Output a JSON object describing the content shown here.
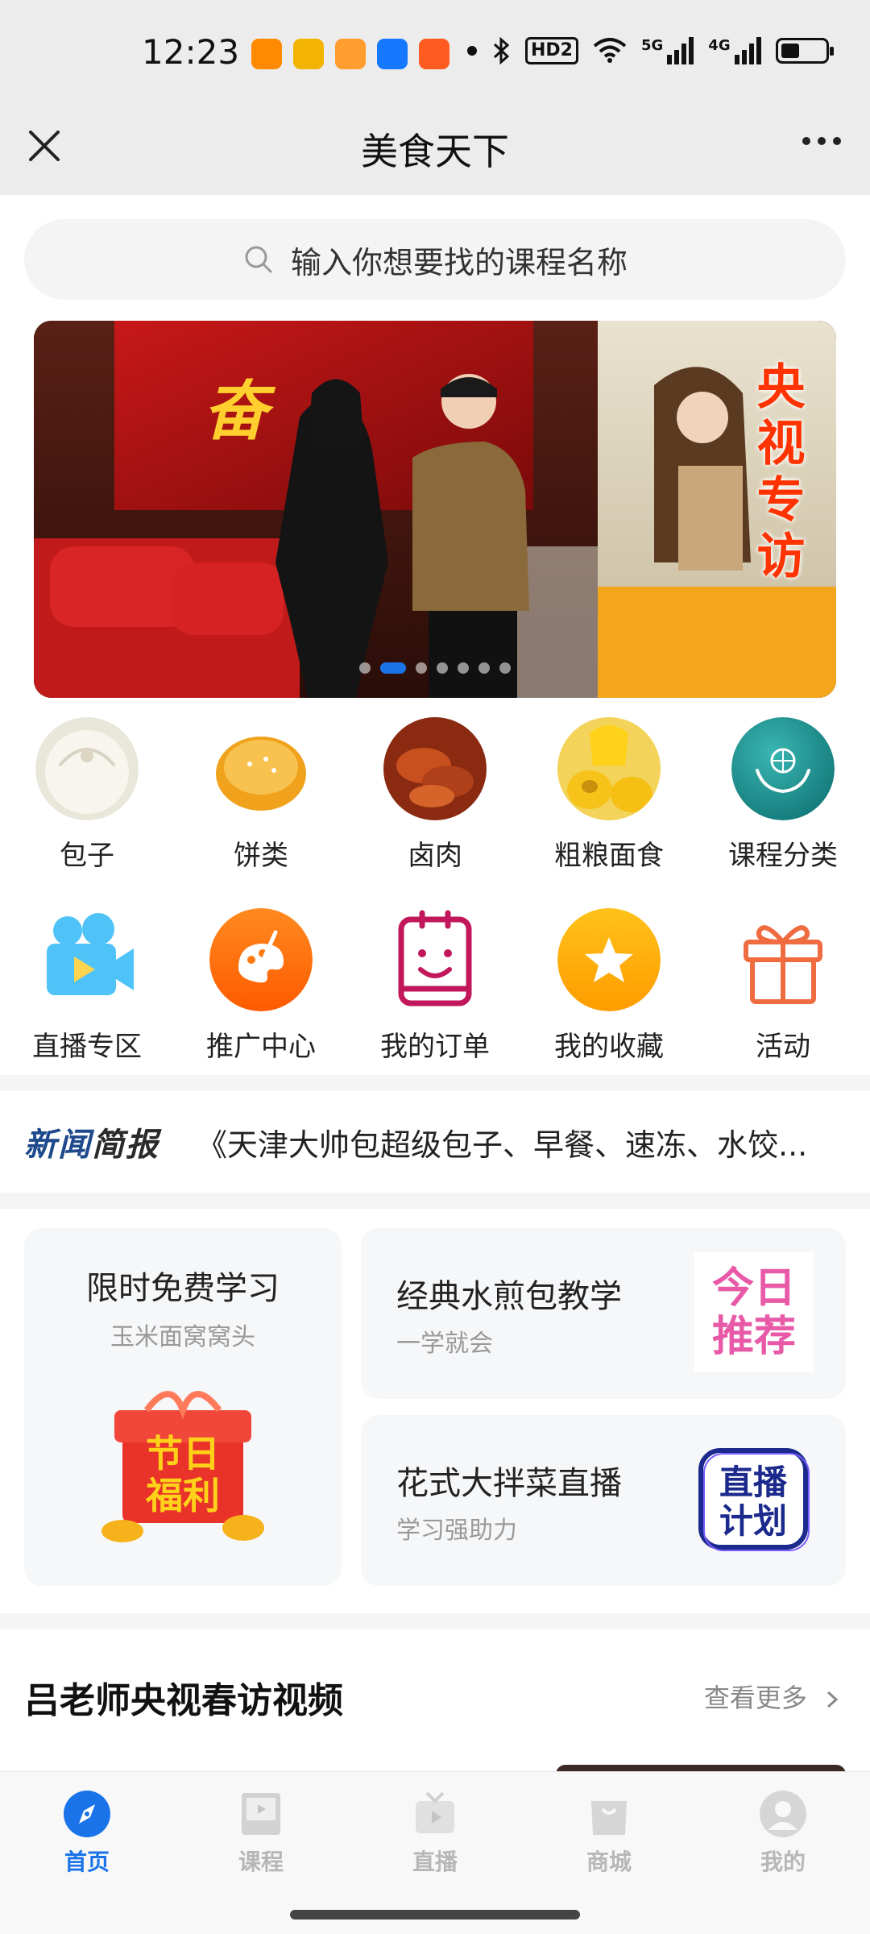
{
  "status_bar": {
    "time": "12:23",
    "hd_label": "HD2",
    "signal1_label": "5G",
    "signal2_label": "4G"
  },
  "title_bar": {
    "title": "美食天下"
  },
  "search": {
    "placeholder": "输入你想要找的课程名称"
  },
  "banner": {
    "tag_text": "央视专访",
    "slide_count": 7,
    "active_slide": 2
  },
  "categories": [
    {
      "label": "包子",
      "icon": "baozi-image"
    },
    {
      "label": "饼类",
      "icon": "pie-image"
    },
    {
      "label": "卤肉",
      "icon": "braised-meat-image"
    },
    {
      "label": "粗粮面食",
      "icon": "corn-wowotou-image"
    },
    {
      "label": "课程分类",
      "icon": "globe-hands-icon"
    }
  ],
  "quick_links": [
    {
      "label": "直播专区",
      "icon": "video-camera-icon"
    },
    {
      "label": "推广中心",
      "icon": "palette-icon"
    },
    {
      "label": "我的订单",
      "icon": "order-clipboard-icon"
    },
    {
      "label": "我的收藏",
      "icon": "star-icon"
    },
    {
      "label": "活动",
      "icon": "gift-icon"
    }
  ],
  "news": {
    "logo_part1": "新闻",
    "logo_part2": "简报",
    "headline": "《天津大帅包超级包子、早餐、速冻、水饺..."
  },
  "promos": {
    "big": {
      "title": "限时免费学习",
      "subtitle": "玉米面窝窝头",
      "badge": "节日福利"
    },
    "small1": {
      "title": "经典水煎包教学",
      "subtitle": "一学就会",
      "badge": "今日推荐"
    },
    "small2": {
      "title": "花式大拌菜直播",
      "subtitle": "学习强助力",
      "badge": "直播计划"
    }
  },
  "section": {
    "title": "吕老师央视春访视频",
    "more_label": "查看更多"
  },
  "tabs": [
    {
      "label": "首页",
      "icon": "compass-icon",
      "active": true
    },
    {
      "label": "课程",
      "icon": "course-book-icon",
      "active": false
    },
    {
      "label": "直播",
      "icon": "tv-icon",
      "active": false
    },
    {
      "label": "商城",
      "icon": "shopping-bag-icon",
      "active": false
    },
    {
      "label": "我的",
      "icon": "profile-icon",
      "active": false
    }
  ],
  "colors": {
    "accent": "#1a73e8",
    "tab_inactive": "#b7b7b7",
    "banner_tag": "#ff3300"
  }
}
